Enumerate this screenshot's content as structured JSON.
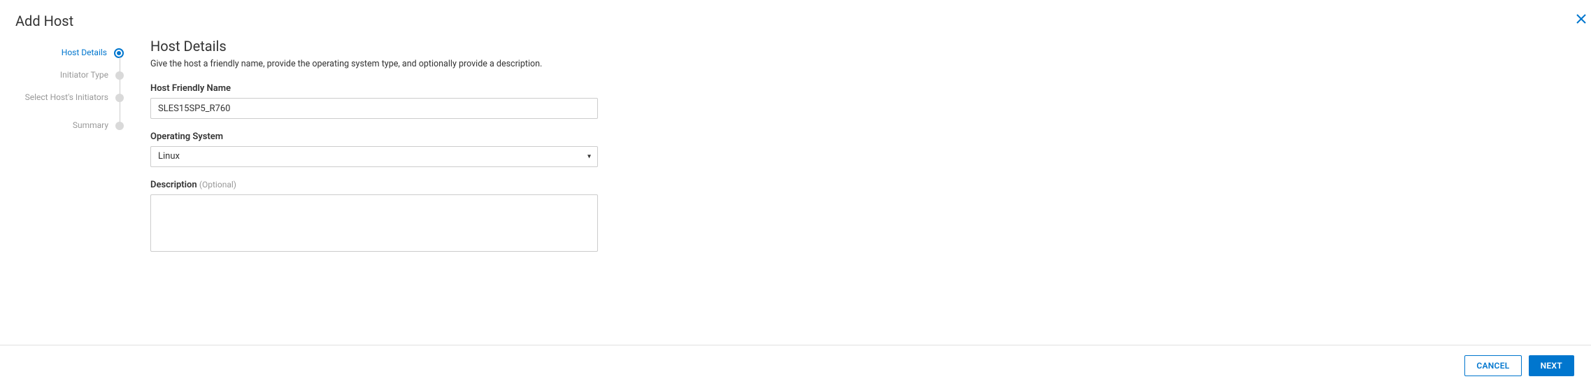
{
  "dialog": {
    "title": "Add Host"
  },
  "stepper": {
    "items": [
      {
        "label": "Host Details",
        "active": true
      },
      {
        "label": "Initiator Type",
        "active": false
      },
      {
        "label": "Select Host's Initiators",
        "active": false
      },
      {
        "label": "Summary",
        "active": false
      }
    ]
  },
  "section": {
    "title": "Host Details",
    "description": "Give the host a friendly name, provide the operating system type, and optionally provide a description."
  },
  "form": {
    "host_name": {
      "label": "Host Friendly Name",
      "value": "SLES15SP5_R760"
    },
    "os": {
      "label": "Operating System",
      "value": "Linux"
    },
    "description": {
      "label": "Description",
      "optional": "(Optional)",
      "value": ""
    }
  },
  "footer": {
    "cancel": "CANCEL",
    "next": "NEXT"
  }
}
